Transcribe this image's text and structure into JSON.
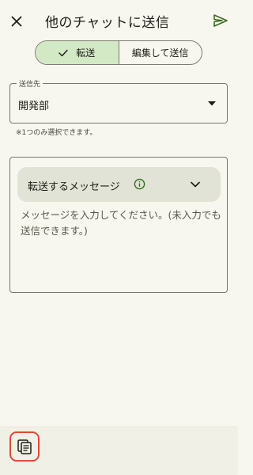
{
  "header": {
    "title": "他のチャットに送信",
    "close_icon": "close-icon",
    "send_icon": "send-icon"
  },
  "mode_toggle": {
    "options": [
      {
        "label": "転送",
        "selected": true
      },
      {
        "label": "編集して送信",
        "selected": false
      }
    ]
  },
  "destination": {
    "label": "送信先",
    "value": "開発部",
    "helper": "※1つのみ選択できます。"
  },
  "message": {
    "forward_label": "転送するメッセージ",
    "placeholder": "メッセージを入力してください。(未入力でも送信できます。)"
  },
  "bottom_bar": {
    "action_icon": "copy-icon"
  },
  "colors": {
    "background": "#f8f7ef",
    "accent": "#386a20",
    "segment_selected": "#d3e8c4",
    "forward_bar": "#e1e3d6",
    "highlight": "#e5463a"
  }
}
